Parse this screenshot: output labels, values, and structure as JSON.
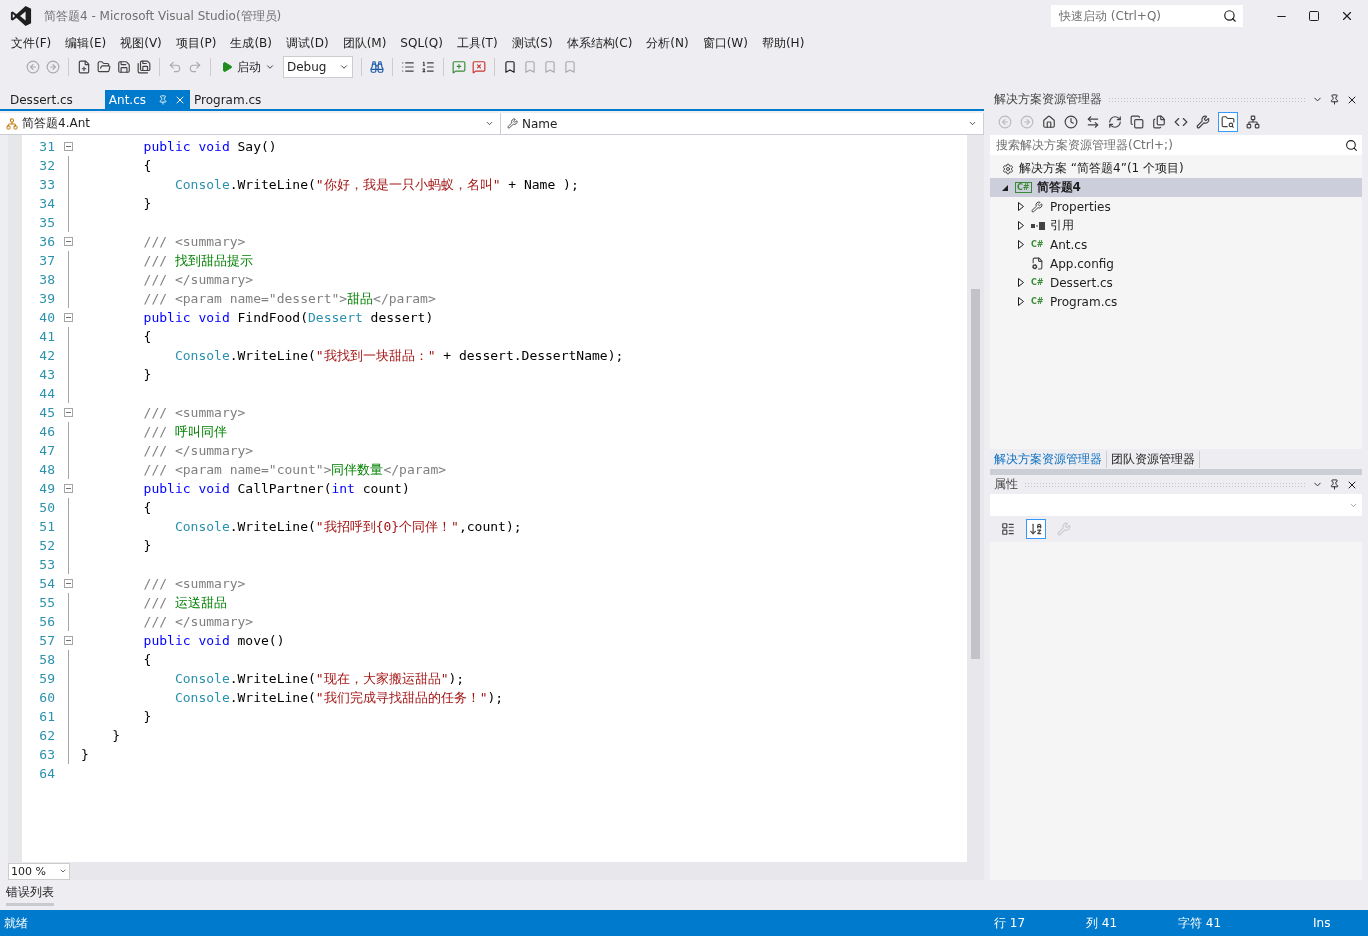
{
  "window": {
    "title": "简答题4 - Microsoft Visual Studio(管理员)",
    "quick_launch": {
      "placeholder": "快速启动 (Ctrl+Q)"
    }
  },
  "menu": [
    "文件(F)",
    "编辑(E)",
    "视图(V)",
    "项目(P)",
    "生成(B)",
    "调试(D)",
    "团队(M)",
    "SQL(Q)",
    "工具(T)",
    "测试(S)",
    "体系结构(C)",
    "分析(N)",
    "窗口(W)",
    "帮助(H)"
  ],
  "toolbar": {
    "start_label": "启动",
    "configuration": "Debug"
  },
  "doc_tabs": [
    {
      "label": "Dessert.cs",
      "selected": false
    },
    {
      "label": "Ant.cs",
      "selected": true
    },
    {
      "label": "Program.cs",
      "selected": false
    }
  ],
  "nav_bar": {
    "type_member": "简答题4.Ant",
    "member": "Name"
  },
  "code_lines": [
    {
      "number": "31",
      "fold": true,
      "tokens": [
        {
          "kind": "keyword",
          "text": "        public void"
        },
        {
          "kind": "plain",
          "text": " Say()"
        }
      ]
    },
    {
      "number": "32",
      "fold": false,
      "tokens": [
        {
          "kind": "plain",
          "text": "        {"
        }
      ]
    },
    {
      "number": "33",
      "fold": false,
      "tokens": [
        {
          "kind": "type",
          "text": "            Console"
        },
        {
          "kind": "plain",
          "text": ".WriteLine("
        },
        {
          "kind": "string",
          "text": "\"你好，我是一只小蚂蚁，名叫\""
        },
        {
          "kind": "plain",
          "text": " + Name );"
        }
      ]
    },
    {
      "number": "34",
      "fold": false,
      "tokens": [
        {
          "kind": "plain",
          "text": "        }"
        }
      ]
    },
    {
      "number": "35",
      "fold": false
    },
    {
      "number": "36",
      "fold": true,
      "tokens": [
        {
          "kind": "doc",
          "text": "        /// <summary>"
        }
      ]
    },
    {
      "number": "37",
      "fold": false,
      "tokens": [
        {
          "kind": "doc",
          "text": "        ///"
        },
        {
          "kind": "comment",
          "text": " 找到甜品提示"
        }
      ]
    },
    {
      "number": "38",
      "fold": false,
      "tokens": [
        {
          "kind": "doc",
          "text": "        /// </summary>"
        }
      ]
    },
    {
      "number": "39",
      "fold": false,
      "tokens": [
        {
          "kind": "doc",
          "text": "        /// <param name=\"dessert\">"
        },
        {
          "kind": "comment",
          "text": "甜品"
        },
        {
          "kind": "doc",
          "text": "</param>"
        }
      ]
    },
    {
      "number": "40",
      "fold": true,
      "tokens": [
        {
          "kind": "keyword",
          "text": "        public void"
        },
        {
          "kind": "plain",
          "text": " FindFood("
        },
        {
          "kind": "type",
          "text": "Dessert"
        },
        {
          "kind": "plain",
          "text": " dessert)"
        }
      ]
    },
    {
      "number": "41",
      "fold": false,
      "tokens": [
        {
          "kind": "plain",
          "text": "        {"
        }
      ]
    },
    {
      "number": "42",
      "fold": false,
      "tokens": [
        {
          "kind": "type",
          "text": "            Console"
        },
        {
          "kind": "plain",
          "text": ".WriteLine("
        },
        {
          "kind": "string",
          "text": "\"我找到一块甜品：\""
        },
        {
          "kind": "plain",
          "text": " + dessert.DessertName);"
        }
      ]
    },
    {
      "number": "43",
      "fold": false,
      "tokens": [
        {
          "kind": "plain",
          "text": "        }"
        }
      ]
    },
    {
      "number": "44",
      "fold": false
    },
    {
      "number": "45",
      "fold": true,
      "tokens": [
        {
          "kind": "doc",
          "text": "        /// <summary>"
        }
      ]
    },
    {
      "number": "46",
      "fold": false,
      "tokens": [
        {
          "kind": "doc",
          "text": "        ///"
        },
        {
          "kind": "comment",
          "text": " 呼叫同伴"
        }
      ]
    },
    {
      "number": "47",
      "fold": false,
      "tokens": [
        {
          "kind": "doc",
          "text": "        /// </summary>"
        }
      ]
    },
    {
      "number": "48",
      "fold": false,
      "tokens": [
        {
          "kind": "doc",
          "text": "        /// <param name=\"count\">"
        },
        {
          "kind": "comment",
          "text": "同伴数量"
        },
        {
          "kind": "doc",
          "text": "</param>"
        }
      ]
    },
    {
      "number": "49",
      "fold": true,
      "tokens": [
        {
          "kind": "keyword",
          "text": "        public void"
        },
        {
          "kind": "plain",
          "text": " CallPartner("
        },
        {
          "kind": "keyword",
          "text": "int"
        },
        {
          "kind": "plain",
          "text": " count)"
        }
      ]
    },
    {
      "number": "50",
      "fold": false,
      "tokens": [
        {
          "kind": "plain",
          "text": "        {"
        }
      ]
    },
    {
      "number": "51",
      "fold": false,
      "tokens": [
        {
          "kind": "type",
          "text": "            Console"
        },
        {
          "kind": "plain",
          "text": ".WriteLine("
        },
        {
          "kind": "string",
          "text": "\"我招呼到{0}个同伴！\""
        },
        {
          "kind": "plain",
          "text": ",count);"
        }
      ]
    },
    {
      "number": "52",
      "fold": false,
      "tokens": [
        {
          "kind": "plain",
          "text": "        }"
        }
      ]
    },
    {
      "number": "53",
      "fold": false
    },
    {
      "number": "54",
      "fold": true,
      "tokens": [
        {
          "kind": "doc",
          "text": "        /// <summary>"
        }
      ]
    },
    {
      "number": "55",
      "fold": false,
      "tokens": [
        {
          "kind": "doc",
          "text": "        ///"
        },
        {
          "kind": "comment",
          "text": " 运送甜品"
        }
      ]
    },
    {
      "number": "56",
      "fold": false,
      "tokens": [
        {
          "kind": "doc",
          "text": "        /// </summary>"
        }
      ]
    },
    {
      "number": "57",
      "fold": true,
      "tokens": [
        {
          "kind": "keyword",
          "text": "        public void"
        },
        {
          "kind": "plain",
          "text": " move()"
        }
      ]
    },
    {
      "number": "58",
      "fold": false,
      "tokens": [
        {
          "kind": "plain",
          "text": "        {"
        }
      ]
    },
    {
      "number": "59",
      "fold": false,
      "tokens": [
        {
          "kind": "type",
          "text": "            Console"
        },
        {
          "kind": "plain",
          "text": ".WriteLine("
        },
        {
          "kind": "string",
          "text": "\"现在，大家搬运甜品\""
        },
        {
          "kind": "plain",
          "text": ");"
        }
      ]
    },
    {
      "number": "60",
      "fold": false,
      "tokens": [
        {
          "kind": "type",
          "text": "            Console"
        },
        {
          "kind": "plain",
          "text": ".WriteLine("
        },
        {
          "kind": "string",
          "text": "\"我们完成寻找甜品的任务！\""
        },
        {
          "kind": "plain",
          "text": ");"
        }
      ]
    },
    {
      "number": "61",
      "fold": false,
      "tokens": [
        {
          "kind": "plain",
          "text": "        }"
        }
      ]
    },
    {
      "number": "62",
      "fold": false,
      "tokens": [
        {
          "kind": "plain",
          "text": "    }"
        }
      ]
    },
    {
      "number": "63",
      "fold": false,
      "tokens": [
        {
          "kind": "plain",
          "text": "}"
        }
      ]
    },
    {
      "number": "64",
      "fold": false
    }
  ],
  "zoom": "100 %",
  "bottom_tab": "错误列表",
  "solution_explorer": {
    "title": "解决方案资源管理器",
    "search": {
      "placeholder": "搜索解决方案资源管理器(Ctrl+;)"
    },
    "solution": "解决方案 “简答题4”(1 个项目)",
    "project": {
      "label": "简答题4",
      "badge": "C#",
      "selected": true,
      "expanded": true,
      "children": [
        {
          "label": "Properties",
          "kind": "properties",
          "expanded": false
        },
        {
          "label": "引用",
          "kind": "references",
          "expanded": false
        },
        {
          "label": "Ant.cs",
          "kind": "csharp",
          "badge": "C#",
          "expanded": false
        },
        {
          "label": "App.config",
          "kind": "config"
        },
        {
          "label": "Dessert.cs",
          "kind": "csharp",
          "badge": "C#",
          "expanded": false
        },
        {
          "label": "Program.cs",
          "kind": "csharp",
          "badge": "C#",
          "expanded": false
        }
      ]
    }
  },
  "panel_tabs": [
    {
      "label": "解决方案资源管理器",
      "selected": true
    },
    {
      "label": "团队资源管理器",
      "selected": false
    }
  ],
  "properties": {
    "title": "属性",
    "views": [
      {
        "kind": "categorized",
        "selected": false
      },
      {
        "kind": "alphabetical",
        "selected": true
      },
      {
        "kind": "property-pages",
        "disabled": true
      }
    ]
  },
  "status_bar": {
    "message": "就绪",
    "line": "行 17",
    "column": "列 41",
    "char": "字符 41",
    "mode": "Ins"
  }
}
